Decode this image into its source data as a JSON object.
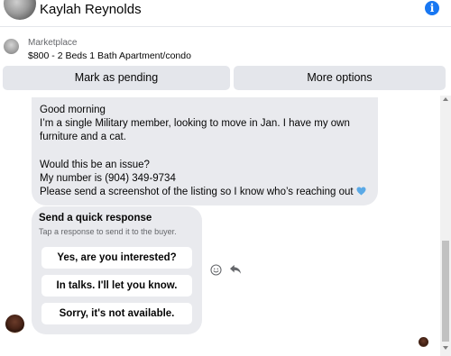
{
  "header": {
    "contact_name": "Kaylah Reynolds",
    "info_icon": "info-icon"
  },
  "marketplace": {
    "label": "Marketplace",
    "listing": "$800 - 2 Beds 1 Bath Apartment/condo",
    "actions": {
      "pending_label": "Mark as pending",
      "more_label": "More options"
    }
  },
  "message": {
    "text": "Good morning\nI’m a single Military member, looking to move in Jan. I have my own furniture and a cat.\n\nWould this be an issue?\nMy number is (904) 349-9734\nPlease send a screenshot of the listing so I know who’s reaching out",
    "emoji": "blue-heart-icon"
  },
  "quick_response": {
    "title": "Send a quick response",
    "subtitle": "Tap a response to send it to the buyer.",
    "options": [
      "Yes, are you interested?",
      "In talks. I'll let you know.",
      "Sorry, it's not available."
    ]
  },
  "colors": {
    "accent": "#1877f2",
    "bubble": "#e9eaee",
    "button_bg": "#e4e6eb",
    "secondary_text": "#65676b",
    "heart": "#5aa9e6"
  }
}
